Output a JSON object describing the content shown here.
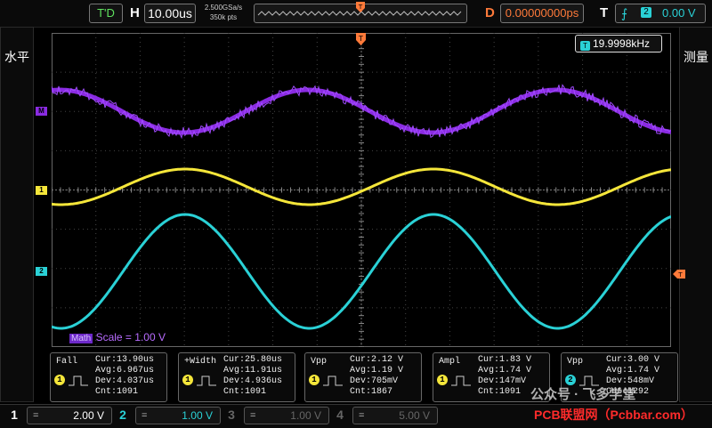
{
  "top": {
    "trigger_status": "T'D",
    "horizontal_letter": "H",
    "timebase": "10.00us",
    "sample_rate": "2.500GSa/s",
    "memory_depth": "350k pts",
    "delay_letter": "D",
    "delay": "0.00000000ps",
    "trigger_letter": "T",
    "trigger_source": "2",
    "trigger_level": "0.00 V"
  },
  "side": {
    "left_label": "水平",
    "right_label": "测量"
  },
  "grid": {
    "frequency": "19.9998kHz",
    "math_marker": "M",
    "ch1_marker": "1",
    "ch2_marker": "2",
    "math_scale_badge": "Math",
    "math_scale": "Scale = 1.00 V"
  },
  "measurements": [
    {
      "name": "Fall",
      "ch": "1",
      "cur": "Cur:13.90us",
      "avg": "Avg:6.967us",
      "dev": "Dev:4.037us",
      "cnt": "Cnt:1091"
    },
    {
      "name": "+Width",
      "ch": "1",
      "cur": "Cur:25.80us",
      "avg": "Avg:11.91us",
      "dev": "Dev:4.936us",
      "cnt": "Cnt:1091"
    },
    {
      "name": "Vpp",
      "ch": "1",
      "cur": "Cur:2.12 V",
      "avg": "Avg:1.19 V",
      "dev": "Dev:705mV",
      "cnt": "Cnt:1867"
    },
    {
      "name": "Ampl",
      "ch": "1",
      "cur": "Cur:1.83 V",
      "avg": "Avg:1.74 V",
      "dev": "Dev:147mV",
      "cnt": "Cnt:1091"
    },
    {
      "name": "Vpp",
      "ch": "2",
      "cur": "Cur:3.00 V",
      "avg": "Avg:1.74 V",
      "dev": "Dev:548mV",
      "cnt": "Cnt:1292"
    }
  ],
  "channels": [
    {
      "num": "1",
      "coupling": "=",
      "scale": "2.00 V",
      "color": "#ffffff"
    },
    {
      "num": "2",
      "coupling": "=",
      "scale": "1.00 V",
      "color": "#2ad1d6"
    },
    {
      "num": "3",
      "coupling": "=",
      "scale": "1.00 V",
      "color": "#666666"
    },
    {
      "num": "4",
      "coupling": "=",
      "scale": "5.00 V",
      "color": "#666666"
    }
  ],
  "watermark": {
    "wechat": "公众号 · 飞多学堂",
    "brand": "PCB联盟网（Pcbbar.com）"
  },
  "colors": {
    "ch1": "#f5e63a",
    "ch2": "#2ad1d6",
    "math": "#8a2be2",
    "trigger": "#ff7a3a"
  }
}
